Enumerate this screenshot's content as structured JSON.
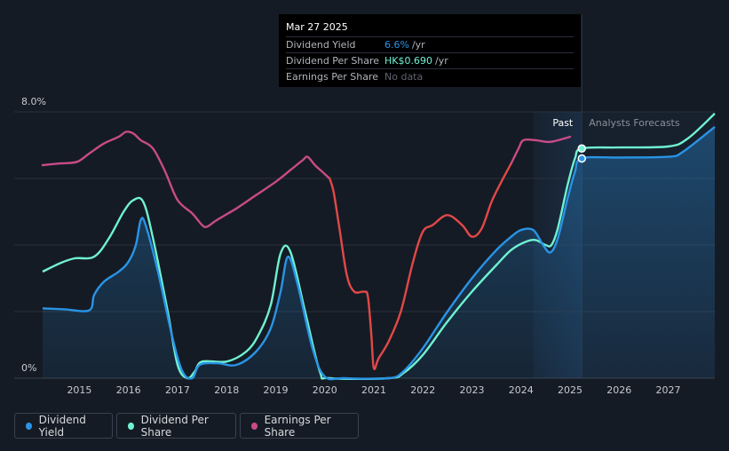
{
  "tooltip": {
    "date": "Mar 27 2025",
    "rows": [
      {
        "label": "Dividend Yield",
        "value": "6.6%",
        "unit": "/yr"
      },
      {
        "label": "Dividend Per Share",
        "value": "HK$0.690",
        "unit": "/yr"
      },
      {
        "label": "Earnings Per Share",
        "value": "No data",
        "unit": ""
      }
    ]
  },
  "region_labels": {
    "past": "Past",
    "forecast": "Analysts Forecasts"
  },
  "legend": [
    {
      "label": "Dividend Yield",
      "color": "#2994e6"
    },
    {
      "label": "Dividend Per Share",
      "color": "#6ff2d2"
    },
    {
      "label": "Earnings Per Share",
      "color": "#c84b87"
    }
  ],
  "colors": {
    "background": "#151b24",
    "dividend_yield": "#2994e6",
    "dividend_per_share": "#6ff2d2",
    "eps_positive": "#c84b87",
    "eps_negative": "#e24848",
    "grid": "#2b313b",
    "axis_text": "#c7cad0"
  },
  "chart_data": {
    "type": "line",
    "ylim": [
      0,
      8
    ],
    "xlim": [
      2014.25,
      2027.95
    ],
    "y_tick_labels": [
      {
        "value": 0,
        "label": "0%"
      },
      {
        "value": 8,
        "label": "8.0%"
      }
    ],
    "y_gridlines": [
      0,
      2,
      4,
      6,
      8
    ],
    "x_ticks": [
      2015,
      2016,
      2017,
      2018,
      2019,
      2020,
      2021,
      2022,
      2023,
      2024,
      2025,
      2026,
      2027
    ],
    "forecast_start": 2025.24,
    "shaded_band_start": 2024.25,
    "series": [
      {
        "name": "Dividend Yield",
        "key": "dividend_yield",
        "filled": true,
        "points": [
          [
            2014.25,
            2.1
          ],
          [
            2014.7,
            2.07
          ],
          [
            2015.2,
            2.04
          ],
          [
            2015.3,
            2.5
          ],
          [
            2015.5,
            2.9
          ],
          [
            2015.8,
            3.2
          ],
          [
            2016.0,
            3.5
          ],
          [
            2016.15,
            4.0
          ],
          [
            2016.25,
            4.75
          ],
          [
            2016.35,
            4.6
          ],
          [
            2016.6,
            3.2
          ],
          [
            2016.9,
            1.2
          ],
          [
            2017.1,
            0.2
          ],
          [
            2017.3,
            0.0
          ],
          [
            2017.45,
            0.4
          ],
          [
            2017.8,
            0.45
          ],
          [
            2018.2,
            0.4
          ],
          [
            2018.6,
            0.8
          ],
          [
            2018.9,
            1.5
          ],
          [
            2019.1,
            2.6
          ],
          [
            2019.25,
            3.65
          ],
          [
            2019.45,
            2.8
          ],
          [
            2019.75,
            0.9
          ],
          [
            2020.0,
            0.05
          ],
          [
            2020.4,
            0.0
          ],
          [
            2021.3,
            0.0
          ],
          [
            2021.6,
            0.2
          ],
          [
            2022.0,
            0.9
          ],
          [
            2022.5,
            2.0
          ],
          [
            2023.0,
            3.0
          ],
          [
            2023.5,
            3.85
          ],
          [
            2023.8,
            4.25
          ],
          [
            2024.0,
            4.45
          ],
          [
            2024.25,
            4.45
          ],
          [
            2024.45,
            4.0
          ],
          [
            2024.6,
            3.78
          ],
          [
            2024.75,
            4.2
          ],
          [
            2024.95,
            5.4
          ],
          [
            2025.1,
            6.2
          ],
          [
            2025.24,
            6.6
          ],
          [
            2026.0,
            6.63
          ],
          [
            2027.0,
            6.65
          ],
          [
            2027.3,
            6.8
          ],
          [
            2027.95,
            7.55
          ]
        ]
      },
      {
        "name": "Dividend Per Share",
        "key": "dividend_per_share",
        "filled": false,
        "points": [
          [
            2014.25,
            3.2
          ],
          [
            2014.6,
            3.45
          ],
          [
            2014.9,
            3.6
          ],
          [
            2015.3,
            3.65
          ],
          [
            2015.6,
            4.2
          ],
          [
            2015.9,
            5.0
          ],
          [
            2016.1,
            5.35
          ],
          [
            2016.3,
            5.3
          ],
          [
            2016.5,
            4.2
          ],
          [
            2016.8,
            2.0
          ],
          [
            2017.0,
            0.4
          ],
          [
            2017.2,
            0.0
          ],
          [
            2017.35,
            0.2
          ],
          [
            2017.5,
            0.5
          ],
          [
            2018.0,
            0.5
          ],
          [
            2018.4,
            0.8
          ],
          [
            2018.65,
            1.3
          ],
          [
            2018.9,
            2.2
          ],
          [
            2019.1,
            3.75
          ],
          [
            2019.3,
            3.8
          ],
          [
            2019.6,
            2.0
          ],
          [
            2019.9,
            0.2
          ],
          [
            2020.1,
            0.0
          ],
          [
            2021.3,
            0.0
          ],
          [
            2021.6,
            0.15
          ],
          [
            2022.0,
            0.7
          ],
          [
            2022.5,
            1.7
          ],
          [
            2023.0,
            2.6
          ],
          [
            2023.5,
            3.4
          ],
          [
            2023.8,
            3.85
          ],
          [
            2024.1,
            4.1
          ],
          [
            2024.3,
            4.15
          ],
          [
            2024.5,
            4.0
          ],
          [
            2024.62,
            4.0
          ],
          [
            2024.75,
            4.5
          ],
          [
            2024.95,
            5.8
          ],
          [
            2025.1,
            6.6
          ],
          [
            2025.24,
            6.9
          ],
          [
            2026.0,
            6.93
          ],
          [
            2027.0,
            6.96
          ],
          [
            2027.4,
            7.2
          ],
          [
            2027.95,
            7.95
          ]
        ]
      },
      {
        "name": "Earnings Per Share",
        "key": "eps",
        "filled": false,
        "points": [
          [
            2014.25,
            6.4
          ],
          [
            2014.6,
            6.45
          ],
          [
            2014.95,
            6.5
          ],
          [
            2015.2,
            6.75
          ],
          [
            2015.5,
            7.05
          ],
          [
            2015.8,
            7.25
          ],
          [
            2015.95,
            7.4
          ],
          [
            2016.1,
            7.35
          ],
          [
            2016.25,
            7.15
          ],
          [
            2016.5,
            6.9
          ],
          [
            2016.75,
            6.2
          ],
          [
            2017.0,
            5.35
          ],
          [
            2017.3,
            4.95
          ],
          [
            2017.5,
            4.6
          ],
          [
            2017.6,
            4.55
          ],
          [
            2017.8,
            4.75
          ],
          [
            2018.2,
            5.1
          ],
          [
            2018.6,
            5.5
          ],
          [
            2019.0,
            5.9
          ],
          [
            2019.3,
            6.25
          ],
          [
            2019.55,
            6.55
          ],
          [
            2019.65,
            6.65
          ],
          [
            2019.8,
            6.4
          ],
          [
            2019.95,
            6.2
          ],
          [
            2020.1,
            6.0
          ],
          [
            2020.18,
            5.6
          ],
          [
            2020.3,
            4.5
          ],
          [
            2020.45,
            3.1
          ],
          [
            2020.6,
            2.6
          ],
          [
            2020.8,
            2.6
          ],
          [
            2020.88,
            2.45
          ],
          [
            2020.95,
            1.3
          ],
          [
            2021.0,
            0.3
          ],
          [
            2021.1,
            0.6
          ],
          [
            2021.3,
            1.1
          ],
          [
            2021.55,
            2.0
          ],
          [
            2021.8,
            3.5
          ],
          [
            2022.0,
            4.4
          ],
          [
            2022.2,
            4.6
          ],
          [
            2022.5,
            4.9
          ],
          [
            2022.8,
            4.6
          ],
          [
            2023.0,
            4.25
          ],
          [
            2023.2,
            4.5
          ],
          [
            2023.4,
            5.3
          ],
          [
            2023.6,
            5.9
          ],
          [
            2023.8,
            6.45
          ],
          [
            2023.95,
            6.9
          ],
          [
            2024.05,
            7.15
          ],
          [
            2024.3,
            7.15
          ],
          [
            2024.6,
            7.1
          ],
          [
            2025.0,
            7.25
          ]
        ]
      }
    ]
  }
}
